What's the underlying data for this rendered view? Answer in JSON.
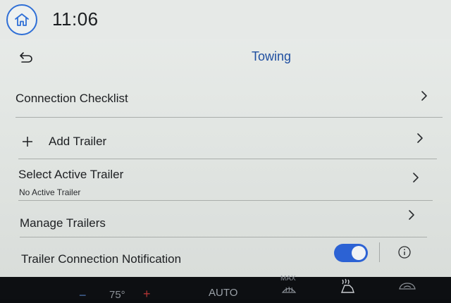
{
  "status": {
    "time": "11:06"
  },
  "header": {
    "title": "Towing"
  },
  "rows": [
    {
      "label": "Connection Checklist"
    },
    {
      "label": "Add Trailer"
    },
    {
      "label": "Select Active Trailer",
      "sublabel": "No Active Trailer"
    },
    {
      "label": "Manage Trailers"
    },
    {
      "label": "Trailer Connection Notification",
      "toggle_on": true
    }
  ],
  "climate": {
    "temp": "75°",
    "auto_label": "AUTO",
    "max_label": "MAX",
    "minus": "−",
    "plus": "+"
  },
  "colors": {
    "accent": "#2c62d4",
    "title": "#1f4fa0"
  },
  "icons": [
    "home-icon",
    "back-arrow-icon",
    "chevron-right-icon",
    "plus-icon",
    "info-icon",
    "max-defrost-icon",
    "heated-seat-icon",
    "recirculation-icon"
  ]
}
